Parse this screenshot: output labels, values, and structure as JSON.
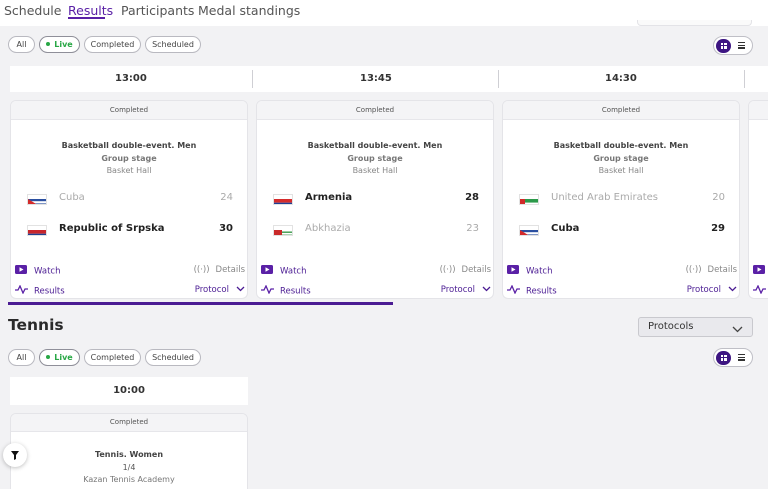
{
  "nav": {
    "tabs": [
      {
        "label": "Schedule"
      },
      {
        "label": "Results"
      },
      {
        "label": "Participants"
      },
      {
        "label": "Medal standings"
      }
    ],
    "active_tab": "Results"
  },
  "filters": {
    "all": "All",
    "live": "Live",
    "completed": "Completed",
    "scheduled": "Scheduled"
  },
  "colors": {
    "accent": "#4b1c93",
    "live": "#28a745"
  },
  "basketball": {
    "times": [
      "13:00",
      "13:45",
      "14:30"
    ],
    "matches": [
      {
        "status": "Completed",
        "event": "Basketball double-event. Men",
        "stage": "Group stage",
        "venue": "Basket Hall",
        "team1": {
          "name": "Cuba",
          "score": "24",
          "flag": "cuba"
        },
        "team2": {
          "name": "Republic of Srpska",
          "score": "30",
          "flag": "srpska"
        },
        "winner": 2
      },
      {
        "status": "Completed",
        "event": "Basketball double-event. Men",
        "stage": "Group stage",
        "venue": "Basket Hall",
        "team1": {
          "name": "Armenia",
          "score": "28",
          "flag": "armenia"
        },
        "team2": {
          "name": "Abkhazia",
          "score": "23",
          "flag": "abkhazia"
        },
        "winner": 1
      },
      {
        "status": "Completed",
        "event": "Basketball double-event. Men",
        "stage": "Group stage",
        "venue": "Basket Hall",
        "team1": {
          "name": "United Arab Emirates",
          "score": "20",
          "flag": "uae"
        },
        "team2": {
          "name": "Cuba",
          "score": "29",
          "flag": "cuba"
        },
        "winner": 2
      }
    ],
    "actions": {
      "watch": "Watch",
      "details": "Details",
      "results": "Results",
      "protocol": "Protocol"
    }
  },
  "tennis": {
    "title": "Tennis",
    "protocols_select": "Protocols",
    "time": "10:00",
    "match": {
      "status": "Completed",
      "event": "Tennis. Women",
      "stage": "1/4",
      "venue": "Kazan Tennis Academy"
    }
  }
}
